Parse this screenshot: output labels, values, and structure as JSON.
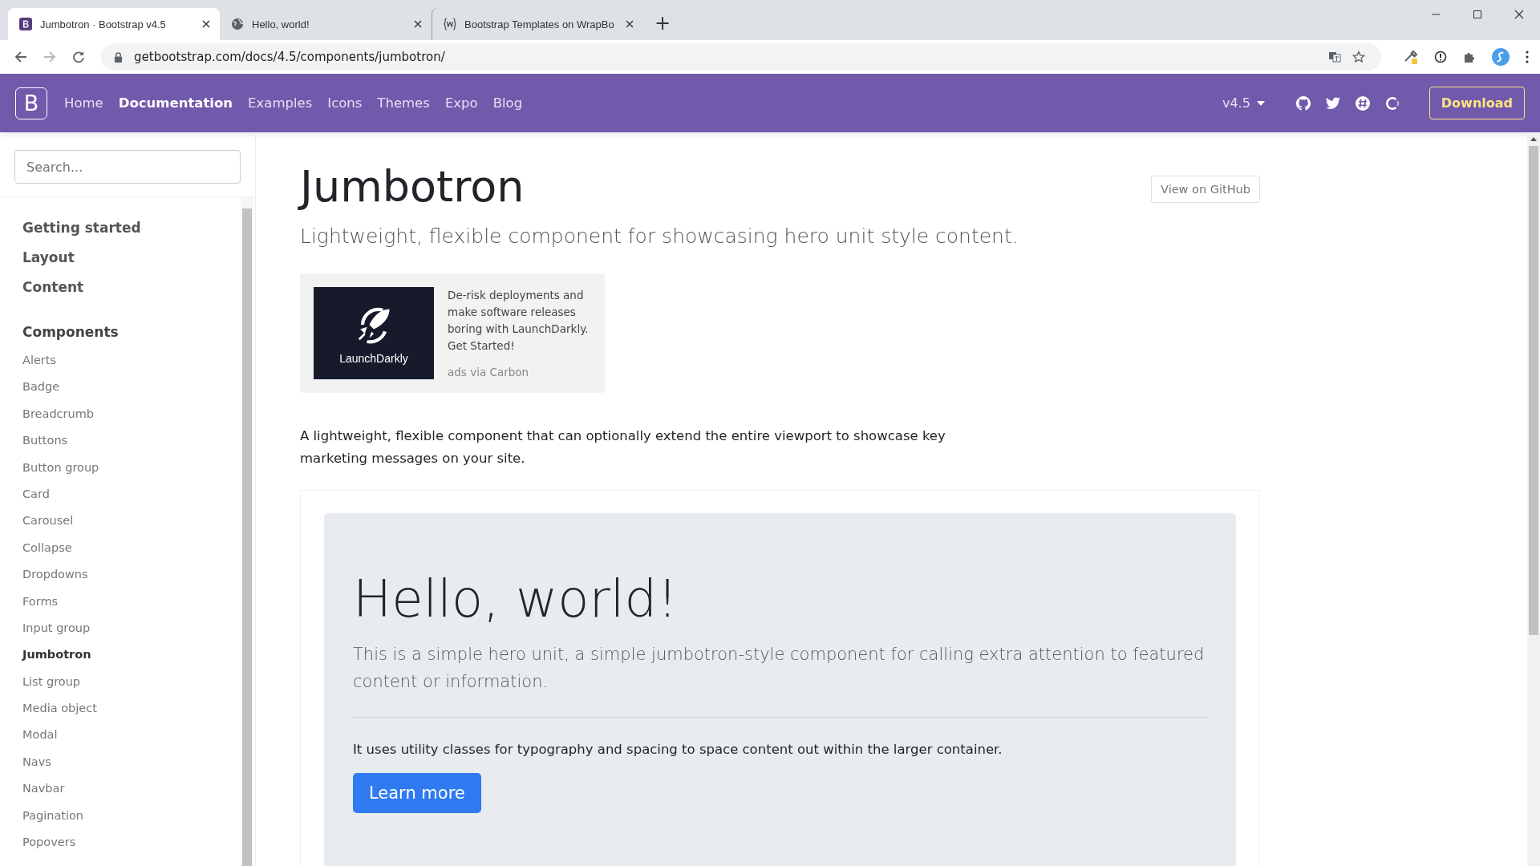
{
  "browser": {
    "tabs": [
      {
        "title": "Jumbotron · Bootstrap v4.5",
        "kind": "bootstrap",
        "selected": true
      },
      {
        "title": "Hello, world!",
        "kind": "globe",
        "selected": false
      },
      {
        "title": "Bootstrap Templates on WrapBo",
        "kind": "wrap",
        "selected": false
      }
    ],
    "new_tab": "+",
    "url": "getbootstrap.com/docs/4.5/components/jumbotron/"
  },
  "navbar": {
    "logo": "B",
    "items": [
      {
        "label": "Home",
        "selected": false
      },
      {
        "label": "Documentation",
        "selected": true
      },
      {
        "label": "Examples",
        "selected": false
      },
      {
        "label": "Icons",
        "selected": false
      },
      {
        "label": "Themes",
        "selected": false
      },
      {
        "label": "Expo",
        "selected": false
      },
      {
        "label": "Blog",
        "selected": false
      }
    ],
    "version": "v4.5",
    "download": "Download"
  },
  "sidebar": {
    "search": {
      "placeholder": "Search..."
    },
    "groups": [
      {
        "label": "Getting started"
      },
      {
        "label": "Layout"
      },
      {
        "label": "Content"
      },
      {
        "label": "Components",
        "children": [
          {
            "label": "Alerts",
            "selected": false
          },
          {
            "label": "Badge",
            "selected": false
          },
          {
            "label": "Breadcrumb",
            "selected": false
          },
          {
            "label": "Buttons",
            "selected": false
          },
          {
            "label": "Button group",
            "selected": false
          },
          {
            "label": "Card",
            "selected": false
          },
          {
            "label": "Carousel",
            "selected": false
          },
          {
            "label": "Collapse",
            "selected": false
          },
          {
            "label": "Dropdowns",
            "selected": false
          },
          {
            "label": "Forms",
            "selected": false
          },
          {
            "label": "Input group",
            "selected": false
          },
          {
            "label": "Jumbotron",
            "selected": true
          },
          {
            "label": "List group",
            "selected": false
          },
          {
            "label": "Media object",
            "selected": false
          },
          {
            "label": "Modal",
            "selected": false
          },
          {
            "label": "Navs",
            "selected": false
          },
          {
            "label": "Navbar",
            "selected": false
          },
          {
            "label": "Pagination",
            "selected": false
          },
          {
            "label": "Popovers",
            "selected": false
          }
        ]
      }
    ]
  },
  "content": {
    "title": "Jumbotron",
    "lead": "Lightweight, flexible component for showcasing hero unit style content.",
    "github_button": "View on GitHub",
    "ad": {
      "logo_text": "LaunchDarkly",
      "text": "De-risk deployments and make software releases boring with LaunchDarkly. Get Started!",
      "via": "ads via Carbon"
    },
    "intro": "A lightweight, flexible component that can optionally extend the entire viewport to showcase key marketing messages on your site.",
    "example": {
      "heading": "Hello, world!",
      "lead": "This is a simple hero unit, a simple jumbotron-style component for calling extra attention to featured content or information.",
      "text": "It uses utility classes for typography and spacing to space content out within the larger container.",
      "button": "Learn more"
    }
  }
}
